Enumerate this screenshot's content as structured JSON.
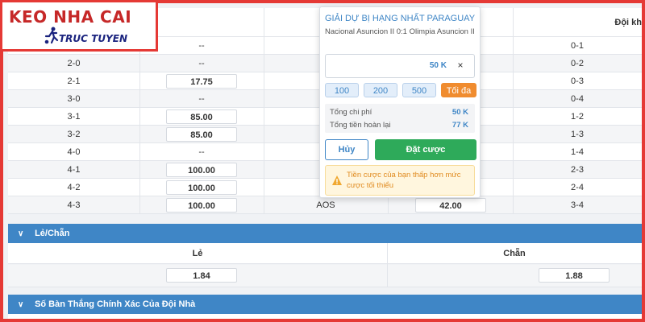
{
  "logo": {
    "line1": "KEO NHA CAI",
    "line2": "TRUC TUYEN"
  },
  "header": {
    "col_right": "Đội kh"
  },
  "score_rows": [
    {
      "left": "",
      "odds_left": "--",
      "mid": "",
      "odds_mid": "",
      "right": "0-1",
      "odds_left_boxed": false
    },
    {
      "left": "2-0",
      "odds_left": "--",
      "mid": "",
      "odds_mid": "",
      "right": "0-2",
      "odds_left_boxed": false
    },
    {
      "left": "2-1",
      "odds_left": "17.75",
      "mid": "",
      "odds_mid": "",
      "right": "0-3",
      "odds_left_boxed": true
    },
    {
      "left": "3-0",
      "odds_left": "--",
      "mid": "",
      "odds_mid": "",
      "right": "0-4",
      "odds_left_boxed": false
    },
    {
      "left": "3-1",
      "odds_left": "85.00",
      "mid": "",
      "odds_mid": "",
      "right": "1-2",
      "odds_left_boxed": true
    },
    {
      "left": "3-2",
      "odds_left": "85.00",
      "mid": "",
      "odds_mid": "",
      "right": "1-3",
      "odds_left_boxed": true
    },
    {
      "left": "4-0",
      "odds_left": "--",
      "mid": "",
      "odds_mid": "",
      "right": "1-4",
      "odds_left_boxed": false
    },
    {
      "left": "4-1",
      "odds_left": "100.00",
      "mid": "",
      "odds_mid": "",
      "right": "2-3",
      "odds_left_boxed": true
    },
    {
      "left": "4-2",
      "odds_left": "100.00",
      "mid": "",
      "odds_mid": "",
      "right": "2-4",
      "odds_left_boxed": true
    },
    {
      "left": "4-3",
      "odds_left": "100.00",
      "mid": "AOS",
      "odds_mid": "42.00",
      "right": "3-4",
      "odds_left_boxed": true
    }
  ],
  "odd_even": {
    "title": "Lẻ/Chẵn",
    "odd_label": "Lẻ",
    "even_label": "Chẵn",
    "odd_value": "1.84",
    "even_value": "1.88"
  },
  "exact_goals": {
    "title": "Số Bàn Thắng Chính Xác Của Đội Nhà"
  },
  "bet_slip": {
    "league": "GIẢI DỰ BỊ HẠNG NHẤT PARAGUAY",
    "match": "Nacional Asuncion II 0:1 Olimpia Asuncion II",
    "stake": "50 K",
    "quick_amounts": [
      "100",
      "200",
      "500"
    ],
    "max_label": "Tối đa",
    "total_cost_label": "Tổng chi phí",
    "total_cost_value": "50 K",
    "total_return_label": "Tổng tiền hoàn lại",
    "total_return_value": "77 K",
    "cancel_label": "Hủy",
    "bet_label": "Đặt cược",
    "warning": "Tiền cược của bạn thấp hơn mức cược tối thiểu"
  },
  "colors": {
    "border_red": "#e53935",
    "section_blue": "#3f86c6",
    "bet_green": "#2eaa5a",
    "max_orange": "#f08c2f",
    "warn_text": "#e08a1e"
  }
}
